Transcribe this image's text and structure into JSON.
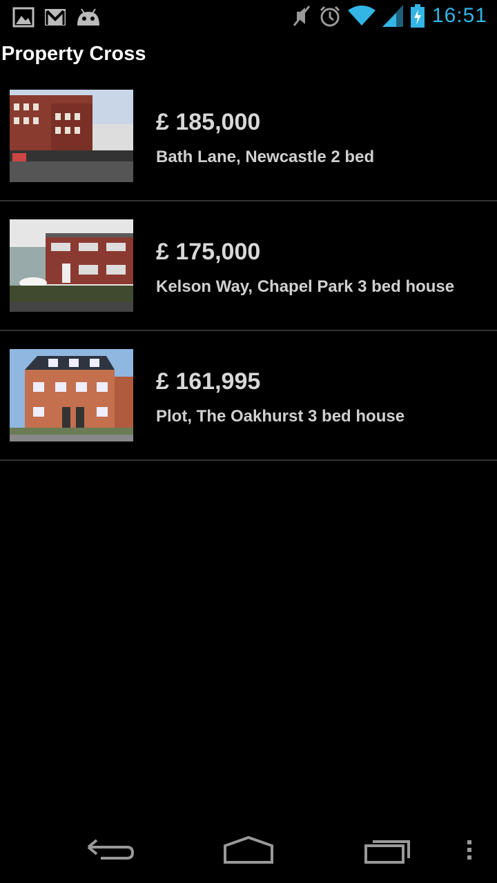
{
  "status_bar": {
    "time": "16:51",
    "icons_left": [
      "gallery-icon",
      "gmail-icon",
      "android-icon"
    ],
    "icons_right": [
      "mute-icon",
      "alarm-icon",
      "wifi-icon",
      "signal-icon",
      "battery-charging-icon"
    ],
    "time_color": "#33b5e5"
  },
  "header": {
    "title": "Property Cross"
  },
  "listings": [
    {
      "price": "£ 185,000",
      "title": "Bath Lane, Newcastle 2 bed",
      "thumbnail": "brick-terrace-street-photo"
    },
    {
      "price": "£ 175,000",
      "title": "Kelson Way, Chapel Park 3 bed house",
      "thumbnail": "semi-detached-house-photo"
    },
    {
      "price": "£ 161,995",
      "title": "Plot, The Oakhurst 3 bed house",
      "thumbnail": "new-build-townhouse-photo"
    }
  ],
  "nav_bar": {
    "buttons": [
      "back-icon",
      "home-icon",
      "recent-apps-icon",
      "overflow-menu-icon"
    ]
  }
}
